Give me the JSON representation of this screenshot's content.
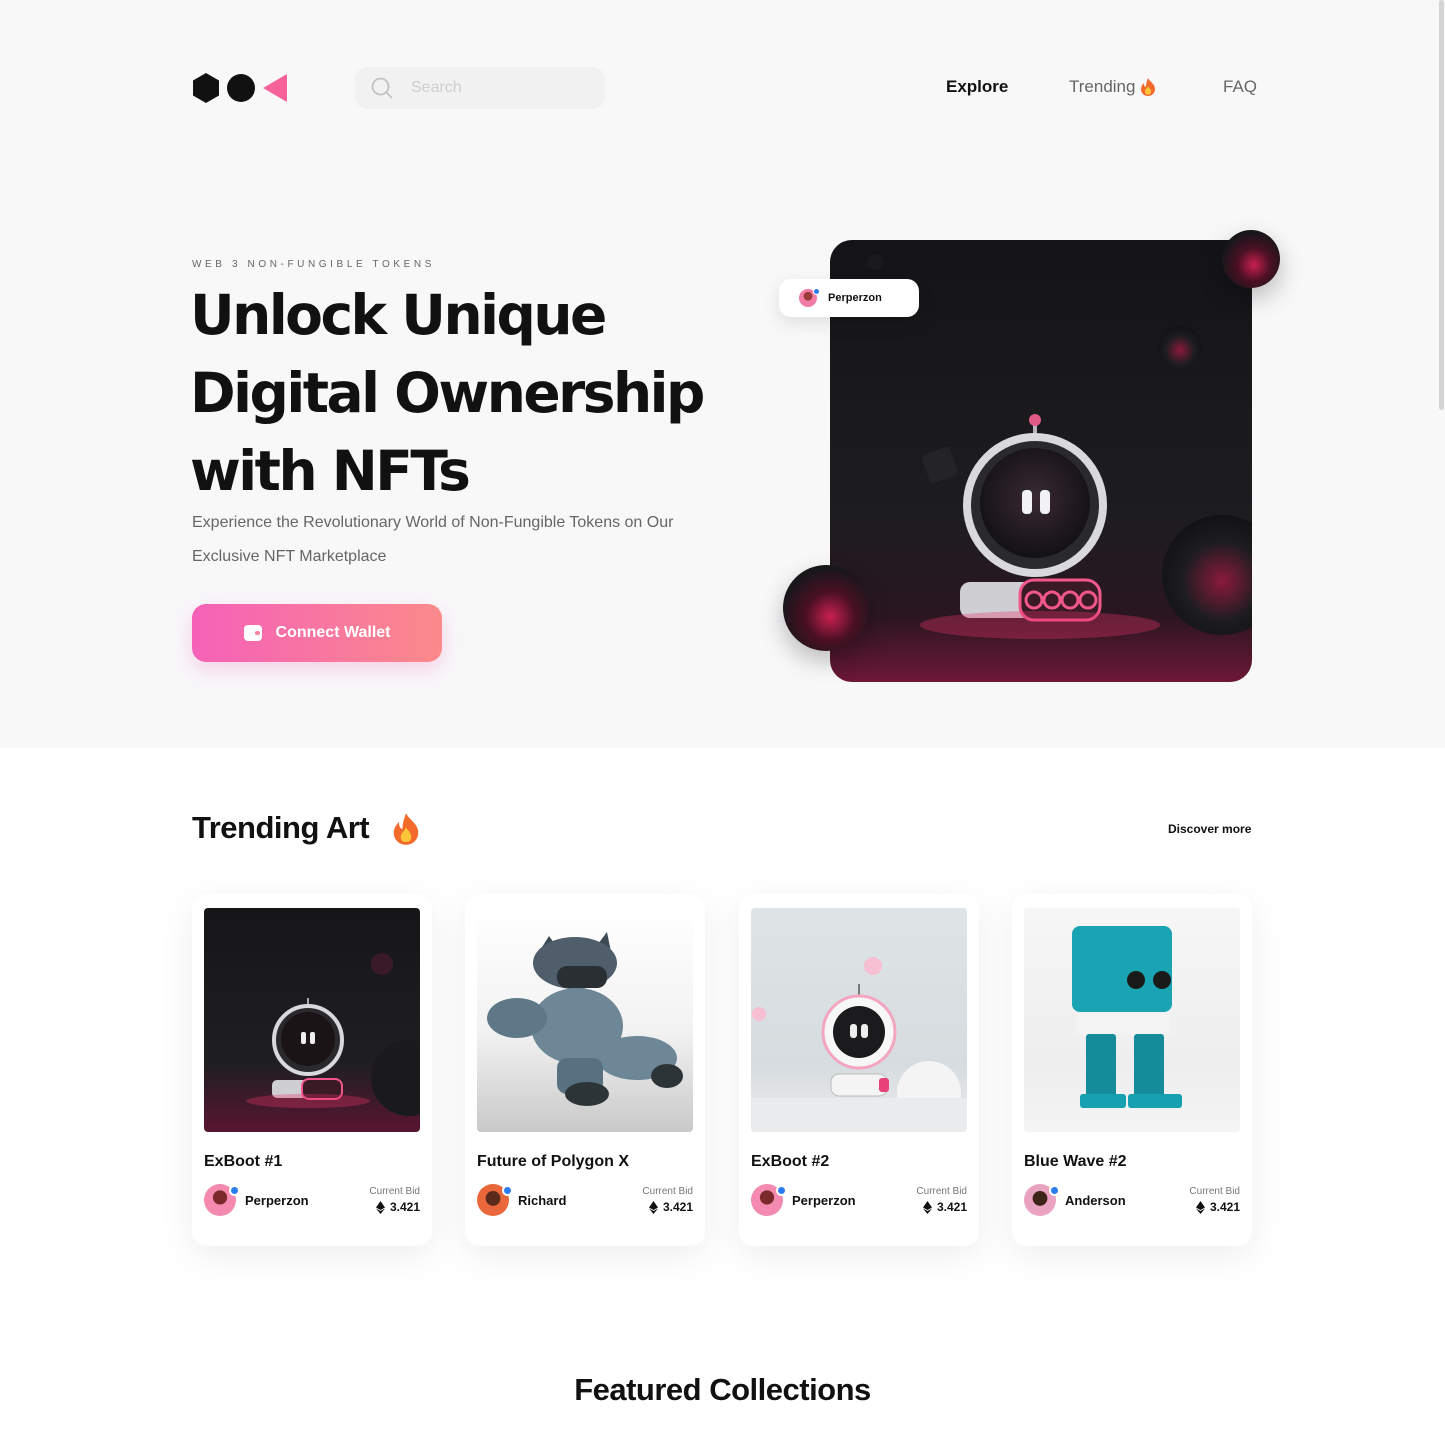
{
  "nav": {
    "search_placeholder": "Search",
    "items": [
      {
        "label": "Explore",
        "active": true
      },
      {
        "label": "Trending",
        "icon": "flame-icon"
      },
      {
        "label": "FAQ"
      }
    ]
  },
  "hero": {
    "eyebrow": "WEB 3 NON-FUNGIBLE TOKENS",
    "title_lines": [
      "Unlock Unique",
      "Digital Ownership",
      "with NFTs"
    ],
    "subtitle": "Experience the Revolutionary World of Non-Fungible Tokens on Our Exclusive NFT Marketplace",
    "cta_label": "Connect Wallet",
    "cta_icon": "wallet-icon",
    "creator": "Perperzon"
  },
  "trending": {
    "title": "Trending Art",
    "title_icon": "flame-icon",
    "discover_label": "Discover more",
    "cards": [
      {
        "title": "ExBoot #1",
        "owner": "Perperzon",
        "bid_label": "Current Bid",
        "bid": "3.421",
        "image": "robot-dark"
      },
      {
        "title": "Future of Polygon X",
        "owner": "Richard",
        "bid_label": "Current Bid",
        "bid": "3.421",
        "image": "robot-dog"
      },
      {
        "title": "ExBoot #2",
        "owner": "Perperzon",
        "bid_label": "Current Bid",
        "bid": "3.421",
        "image": "robot-light"
      },
      {
        "title": "Blue Wave #2",
        "owner": "Anderson",
        "bid_label": "Current Bid",
        "bid": "3.421",
        "image": "blue-block-robot"
      }
    ]
  },
  "featured": {
    "title": "Featured Collections"
  },
  "colors": {
    "accent_start": "#f561b8",
    "accent_end": "#fb8a8a",
    "text": "#111111",
    "verified": "#2b7cf0"
  }
}
